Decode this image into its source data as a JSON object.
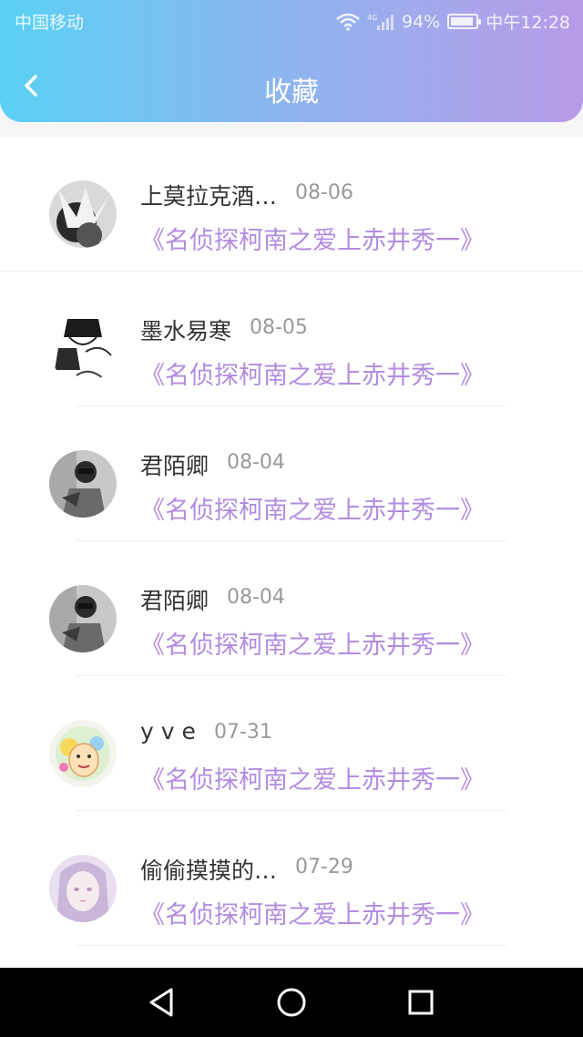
{
  "status_bar": {
    "carrier": "中国移动",
    "network": "4G",
    "battery": "94%",
    "battery_level": 0.94,
    "time": "中午12:28"
  },
  "header": {
    "title": "收藏",
    "back_icon": "chevron-left-icon"
  },
  "favorites": [
    {
      "name": "上莫拉克酒…",
      "date": "08-06",
      "title": "《名侦探柯南之爱上赤井秀一》",
      "avatar": "avatar-photo-bw"
    },
    {
      "name": "墨水易寒",
      "date": "08-05",
      "title": "《名侦探柯南之爱上赤井秀一》",
      "avatar": "avatar-manga-sketch"
    },
    {
      "name": "君陌卿",
      "date": "08-04",
      "title": "《名侦探柯南之爱上赤井秀一》",
      "avatar": "avatar-photo-gray"
    },
    {
      "name": "君陌卿",
      "date": "08-04",
      "title": "《名侦探柯南之爱上赤井秀一》",
      "avatar": "avatar-photo-gray"
    },
    {
      "name": "y v e",
      "date": "07-31",
      "title": "《名侦探柯南之爱上赤井秀一》",
      "avatar": "avatar-cartoon"
    },
    {
      "name": "偷偷摸摸的…",
      "date": "07-29",
      "title": "《名侦探柯南之爱上赤井秀一》",
      "avatar": "avatar-anime-girl"
    }
  ],
  "nav_bar": {
    "back_icon": "triangle-back-icon",
    "home_icon": "circle-home-icon",
    "recents_icon": "square-recents-icon"
  },
  "colors": {
    "header_gradient_start": "#5ad1f4",
    "header_gradient_end": "#b89be9",
    "title_accent": "#b28ce0"
  }
}
